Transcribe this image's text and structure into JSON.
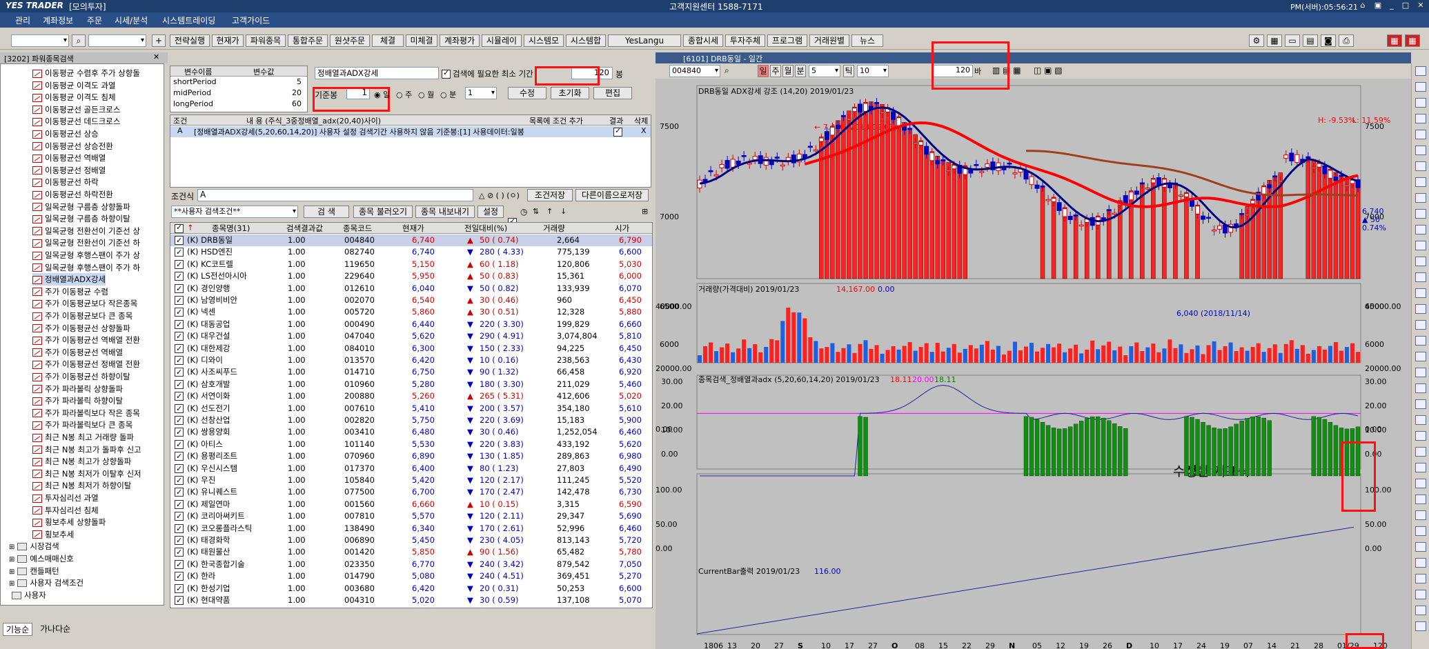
{
  "title": {
    "app": "YES TRADER",
    "mode": "[모의투자]",
    "center": "고객지원센터 1588-7171",
    "clock": "PM(서버):05:56:21"
  },
  "menu": [
    "관리",
    "계좌정보",
    "주문",
    "시세/분석",
    "시스템트레이딩",
    "고객가이드"
  ],
  "toolbar": [
    "전략실행",
    "현재가",
    "파워종목",
    "통합주문",
    "원샷주문",
    "체결",
    "미체결",
    "계좌평가",
    "시뮬레이",
    "시스템모",
    "시스템합",
    "YesLangu",
    "종합시세",
    "투자주체",
    "프로그램",
    "거래원별",
    "뉴스"
  ],
  "left": {
    "header": "[3202] 파워종목검색",
    "tabs": [
      "기능순",
      "가나다순"
    ],
    "items": [
      "이동평균 수렴후 주가 상향돌",
      "이동평균 이격도 과열",
      "이동평균 이격도 침체",
      "이동평균선 골든크로스",
      "이동평균선 데드크로스",
      "이동평균선 상승",
      "이동평균선 상승전환",
      "이동평균선 역배열",
      "이동평균선 정배열",
      "이동평균선 하락",
      "이동평균선 하락전환",
      "일목균형 구름층 상향돌파",
      "일목균형 구름층 하향이탈",
      "일목균형 전환선이 기준선 상",
      "일목균형 전환선이 기준선 하",
      "일목균형 후행스팬이 주가 상",
      "일목균형 후행스팬이 주가 하",
      "정배열과ADX강세",
      "주가 이동평균 수렴",
      "주가 이동평균보다 작은종목",
      "주가 이동평균보다 큰 종목",
      "주가 이동평균선 상향돌파",
      "주가 이동평균선 역배열 전환",
      "주가 이동평균선 역배열",
      "주가 이동평균선 정배열 전환",
      "주가 이동평균선 하향이탈",
      "주가 파라볼릭 상향돌파",
      "주가 파라볼릭 하향이탈",
      "주가 파라볼릭보다 작은 종목",
      "주가 파라볼릭보다 큰 종목",
      "최근 N봉 최고 거래량 돌파",
      "최근 N봉 최고가 돌파후 신고",
      "최근 N봉 최고가 상향돌파",
      "최근 N봉 최저가 이탈후 신저",
      "최근 N봉 최저가 하향이탈",
      "투자심리선 과열",
      "투자심리선 침체",
      "횡보추세 상향돌파",
      "횡보추세"
    ],
    "folders": [
      "시장검색",
      "예스매매신호",
      "캔들패턴",
      "사용자 검색조건",
      "사용자"
    ]
  },
  "params": {
    "h1": "변수이름",
    "h2": "변수값",
    "rows": [
      [
        "shortPeriod",
        "5"
      ],
      [
        "midPeriod",
        "20"
      ],
      [
        "longPeriod",
        "60"
      ]
    ]
  },
  "cond": {
    "name": "정배열과ADX강세",
    "chk": "검색에 필요한 최소 기간",
    "period": "120",
    "unit": "봉",
    "base": "기준봉",
    "baseval": "1",
    "radios": [
      "일",
      "주",
      "월",
      "분"
    ],
    "minval": "1",
    "btns": [
      "수정",
      "초기화",
      "편집"
    ],
    "h": [
      "조건",
      "내 용 (주식_3중정배열_adx(20,40)사이)",
      "목록에 조건 추가",
      "결과",
      "삭제"
    ],
    "row": [
      "A",
      "[정배열과ADX강세(5,20,60,14,20)] 사용자 설정 검색기간 사용하지 않음 기준봉:[1] 사용데이터:일봉",
      "X"
    ],
    "formula_label": "조건식",
    "formula": "A",
    "save": "조건저장",
    "saveas": "다른이름으로저장",
    "combo": "**사용자 검색조건**",
    "search": "검 색",
    "load": "종목 불러오기",
    "export": "종목 내보내기",
    "setting": "설정"
  },
  "results": {
    "headers": [
      "종목명(31)",
      "검색결과값",
      "종목코드",
      "현재가",
      "전일대비(%)",
      "거래량",
      "시가"
    ],
    "rows": [
      [
        "(K) DRB동일",
        "1.00",
        "004840",
        "6,740",
        "▲",
        "50 ( 0.74)",
        "2,664",
        "6,790"
      ],
      [
        "(K) HSD엔진",
        "1.00",
        "082740",
        "6,740",
        "▼",
        "280 ( 4.33)",
        "775,139",
        "6,600"
      ],
      [
        "(K) KC코트렐",
        "1.00",
        "119650",
        "5,150",
        "▲",
        "60 ( 1.18)",
        "120,806",
        "5,030"
      ],
      [
        "(K) LS전선아시아",
        "1.00",
        "229640",
        "5,950",
        "▲",
        "50 ( 0.83)",
        "15,361",
        "6,000"
      ],
      [
        "(K) 경인양행",
        "1.00",
        "012610",
        "6,040",
        "▼",
        "50 ( 0.82)",
        "133,939",
        "6,070"
      ],
      [
        "(K) 남영비비안",
        "1.00",
        "002070",
        "6,540",
        "▲",
        "30 ( 0.46)",
        "960",
        "6,450"
      ],
      [
        "(K) 넥센",
        "1.00",
        "005720",
        "5,860",
        "▲",
        "30 ( 0.51)",
        "12,328",
        "5,880"
      ],
      [
        "(K) 대동공업",
        "1.00",
        "000490",
        "6,440",
        "▼",
        "220 ( 3.30)",
        "199,829",
        "6,660"
      ],
      [
        "(K) 대우건설",
        "1.00",
        "047040",
        "5,620",
        "▼",
        "290 ( 4.91)",
        "3,074,804",
        "5,810"
      ],
      [
        "(K) 대한제강",
        "1.00",
        "084010",
        "6,300",
        "▼",
        "150 ( 2.33)",
        "94,225",
        "6,450"
      ],
      [
        "(K) 디와이",
        "1.00",
        "013570",
        "6,420",
        "▼",
        "10 ( 0.16)",
        "238,563",
        "6,430"
      ],
      [
        "(K) 사조씨푸드",
        "1.00",
        "014710",
        "6,750",
        "▼",
        "90 ( 1.32)",
        "66,458",
        "6,920"
      ],
      [
        "(K) 삼호개발",
        "1.00",
        "010960",
        "5,280",
        "▼",
        "180 ( 3.30)",
        "211,029",
        "5,460"
      ],
      [
        "(K) 서연이화",
        "1.00",
        "200880",
        "5,260",
        "▲",
        "265 ( 5.31)",
        "412,606",
        "5,020"
      ],
      [
        "(K) 선도전기",
        "1.00",
        "007610",
        "5,410",
        "▼",
        "200 ( 3.57)",
        "354,180",
        "5,610"
      ],
      [
        "(K) 선창산업",
        "1.00",
        "002820",
        "5,750",
        "▼",
        "220 ( 3.69)",
        "15,183",
        "5,900"
      ],
      [
        "(K) 쌍용양회",
        "1.00",
        "003410",
        "6,480",
        "▼",
        "30 ( 0.46)",
        "1,252,054",
        "6,460"
      ],
      [
        "(K) 아티스",
        "1.00",
        "101140",
        "5,530",
        "▼",
        "220 ( 3.83)",
        "433,192",
        "5,620"
      ],
      [
        "(K) 용평리조트",
        "1.00",
        "070960",
        "6,890",
        "▼",
        "130 ( 1.85)",
        "289,863",
        "6,980"
      ],
      [
        "(K) 우신시스템",
        "1.00",
        "017370",
        "6,400",
        "▼",
        "80 ( 1.23)",
        "27,803",
        "6,490"
      ],
      [
        "(K) 우진",
        "1.00",
        "105840",
        "5,420",
        "▼",
        "120 ( 2.17)",
        "111,245",
        "5,520"
      ],
      [
        "(K) 유니퀘스트",
        "1.00",
        "077500",
        "6,700",
        "▼",
        "170 ( 2.47)",
        "142,478",
        "6,730"
      ],
      [
        "(K) 제일연마",
        "1.00",
        "001560",
        "6,660",
        "▲",
        "10 ( 0.15)",
        "3,315",
        "6,590"
      ],
      [
        "(K) 코리아써키트",
        "1.00",
        "007810",
        "5,570",
        "▼",
        "120 ( 2.11)",
        "29,347",
        "5,690"
      ],
      [
        "(K) 코오롱플라스틱",
        "1.00",
        "138490",
        "6,340",
        "▼",
        "170 ( 2.61)",
        "52,996",
        "6,460"
      ],
      [
        "(K) 태경화학",
        "1.00",
        "006890",
        "5,450",
        "▼",
        "230 ( 4.05)",
        "813,143",
        "5,720"
      ],
      [
        "(K) 태원물산",
        "1.00",
        "001420",
        "5,850",
        "▲",
        "90 ( 1.56)",
        "65,482",
        "5,780"
      ],
      [
        "(K) 한국종합기술",
        "1.00",
        "023350",
        "6,770",
        "▼",
        "240 ( 3.42)",
        "879,542",
        "7,050"
      ],
      [
        "(K) 한라",
        "1.00",
        "014790",
        "5,080",
        "▼",
        "240 ( 4.51)",
        "369,451",
        "5,270"
      ],
      [
        "(K) 한성기업",
        "1.00",
        "003680",
        "6,420",
        "▼",
        "20 ( 0.31)",
        "50,253",
        "6,600"
      ],
      [
        "(K) 현대약품",
        "1.00",
        "004310",
        "5,020",
        "▼",
        "30 ( 0.59)",
        "137,108",
        "5,070"
      ]
    ]
  },
  "chart": {
    "wintitle": "[6101] DRB동일 - 일간",
    "code": "004840",
    "period_combo": "5",
    "tick_combo": "10",
    "count": "120",
    "count_unit": "바",
    "pane1": {
      "label": "DRB동일 ADX강세 강조 (14,20) 2019/01/23",
      "hl": "H: -9.53%",
      "ll": "L: 11.59%",
      "hi_note": "← 7,450 (2018/09/03)",
      "lo_note": "6,040 (2018/11/14)",
      "last": "6,740",
      "chg": "▲ 50",
      "pct": "0.74%",
      "yticks": [
        "7500",
        "7000",
        "6500",
        "6000"
      ]
    },
    "pane2": {
      "label": "거래량(가격대비)",
      "date": "2019/01/23",
      "val": "14,167.00",
      "valb": "0.00",
      "yticks": [
        "40000.00",
        "20000.00",
        "0.00"
      ]
    },
    "pane3": {
      "label": "종목검색_정배열과adx (5,20,60,14,20) 2019/01/23",
      "v1": "18.11",
      "v2": "20.00",
      "v3": "18.11",
      "note": "수정한 지표식",
      "yticks": [
        "30.00",
        "20.00",
        "10.00",
        "0.00"
      ]
    },
    "pane4": {
      "label": "CurrentBar출력",
      "date": "2019/01/23",
      "val": "116.00",
      "yticks": [
        "100.00",
        "50.00",
        "0.00"
      ]
    },
    "xticks": [
      "1806",
      "13",
      "20",
      "27",
      "S",
      "10",
      "17",
      "27",
      "O",
      "08",
      "15",
      "22",
      "29",
      "N",
      "05",
      "12",
      "19",
      "26",
      "D",
      "10",
      "17",
      "24",
      "19",
      "07",
      "14",
      "21",
      "28",
      "01/29"
    ],
    "bottom_count": "120"
  },
  "colors": {
    "titlebar": "#1e3f6e",
    "menubar": "#2a4f86",
    "up": "#d00000",
    "down": "#0000c0",
    "bar_red": "#ff2020",
    "bar_green": "#109010",
    "ma_blue": "#000080",
    "ma_red": "#ff0000",
    "ma_brown": "#a0401a",
    "highlight": "#ff1010"
  }
}
